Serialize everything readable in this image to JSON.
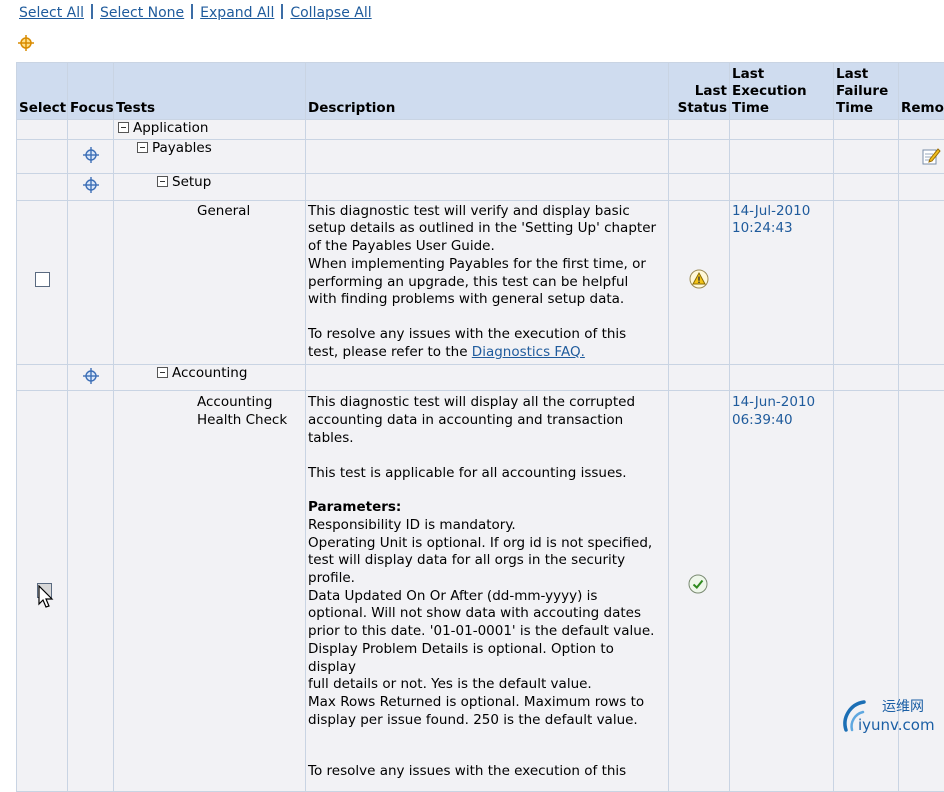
{
  "toolbar": {
    "select_all": "Select All",
    "select_none": "Select None",
    "expand_all": "Expand All",
    "collapse_all": "Collapse All"
  },
  "table": {
    "headers": {
      "select": "Select",
      "focus": "Focus",
      "tests": "Tests",
      "description": "Description",
      "last_status": "Last Status",
      "last_execution_time": "Last Execution Time",
      "last_failure_time": "Last Failure Time",
      "remove": "Remo"
    },
    "rows": {
      "application": {
        "label": "Application"
      },
      "payables": {
        "label": "Payables"
      },
      "setup": {
        "label": "Setup"
      },
      "general": {
        "name": "General",
        "description_lines": [
          "This diagnostic test will verify and display basic",
          "setup details as outlined in the 'Setting Up' chapter",
          "of the Payables User Guide.",
          "When implementing Payables for the first time, or",
          "performing an upgrade, this test can be helpful",
          "with finding problems with general setup data.",
          "",
          "To resolve any issues with the execution of this"
        ],
        "faq_prefix": "test, please refer to the ",
        "faq_link": "Diagnostics FAQ.",
        "status": "warning",
        "execution_date": "14-Jul-2010",
        "execution_time": "10:24:43"
      },
      "accounting": {
        "label": "Accounting"
      },
      "accounting_health_check": {
        "name_line1": "Accounting",
        "name_line2": "Health Check",
        "description_intro": [
          "This diagnostic test will display all the corrupted",
          "accounting data in accounting and transaction",
          "tables.",
          "",
          "This test is applicable for all accounting issues.",
          ""
        ],
        "parameters_heading": "Parameters:",
        "parameters_lines": [
          "Responsibility ID is mandatory.",
          "Operating Unit is optional. If org id is not specified,",
          "test will display data for all orgs in the security",
          "profile.",
          "Data Updated On Or After (dd-mm-yyyy) is",
          "optional. Will not show data with accouting dates",
          "prior to this date. '01-01-0001' is the default value.",
          "Display Problem Details is optional. Option to display",
          "full details or not. Yes is the default value.",
          "Max Rows Returned is optional. Maximum rows to",
          "display per issue found. 250 is the default value.",
          "",
          "",
          "To resolve any issues with the execution of this"
        ],
        "status": "success",
        "execution_date": "14-Jun-2010",
        "execution_time": "06:39:40"
      }
    }
  },
  "icons": {
    "focus": "crosshair-focus-icon",
    "remove": "edit-icon",
    "collapse": "minus-box-icon",
    "warning": "warning-triangle-icon",
    "success": "checkmark-circle-icon"
  },
  "colors": {
    "link": "#1f5b9c",
    "header_bg": "#cfdcef",
    "cell_bg": "#f2f2f5",
    "grid_border": "#c9d4e3"
  },
  "watermark": {
    "cn": "运维网",
    "url": "iyunv.com"
  }
}
